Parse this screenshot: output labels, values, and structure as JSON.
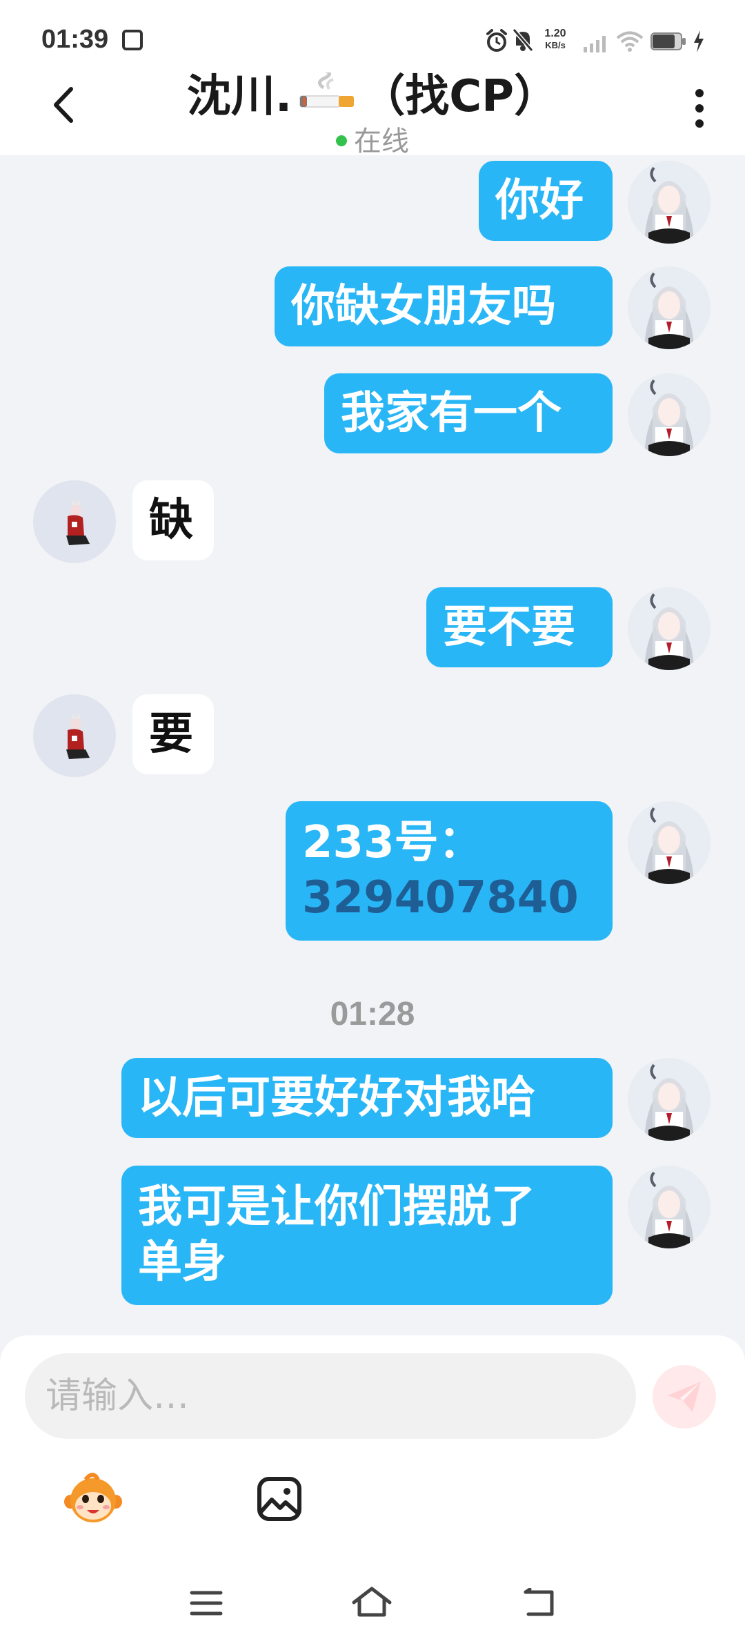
{
  "status_bar": {
    "time": "01:39",
    "net_speed_value": "1.20",
    "net_speed_unit": "KB/s"
  },
  "header": {
    "title_prefix": "沈川.",
    "title_suffix": "（找CP）",
    "online_status": "在线"
  },
  "messages": [
    {
      "side": "out",
      "text": "你好"
    },
    {
      "side": "out",
      "text": "你缺女朋友吗"
    },
    {
      "side": "out",
      "text": "我家有一个"
    },
    {
      "side": "in",
      "text": "缺"
    },
    {
      "side": "out",
      "text": "要不要"
    },
    {
      "side": "in",
      "text": "要"
    },
    {
      "side": "out",
      "text_line1": "233号：",
      "text_line2": "329407840"
    },
    {
      "type": "timestamp",
      "text": "01:28"
    },
    {
      "side": "out",
      "text": "以后可要好好对我哈"
    },
    {
      "side": "out",
      "text_line1": "我可是让你们摆脱了",
      "text_line2": "单身"
    }
  ],
  "composer": {
    "placeholder": "请输入…",
    "send_icon": "send-icon"
  },
  "toolbar": {
    "tools": [
      "emoji-mascot-icon",
      "image-icon"
    ]
  },
  "nav": {
    "icons": [
      "menu-icon",
      "home-icon",
      "back-icon"
    ]
  },
  "colors": {
    "outgoing_bubble": "#29b6f6",
    "incoming_bubble": "#ffffff",
    "chat_background": "#f1f3f6",
    "number_text": "#1e5e94",
    "online_dot": "#33c24d",
    "send_button": "#ffe9ea"
  }
}
